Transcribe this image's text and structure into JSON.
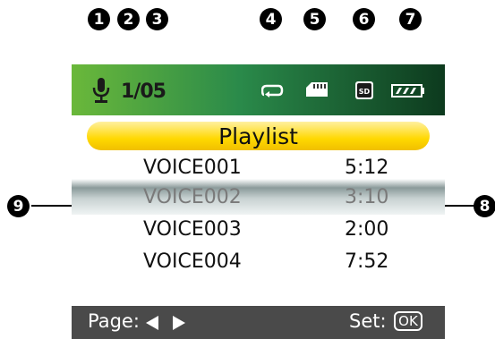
{
  "callouts": [
    "1",
    "2",
    "3",
    "4",
    "5",
    "6",
    "7",
    "8",
    "9"
  ],
  "status": {
    "track": "1/05"
  },
  "playlist": {
    "title": "Playlist",
    "items": [
      {
        "name": "VOICE001",
        "time": "5:12"
      },
      {
        "name": "VOICE002",
        "time": "3:10"
      },
      {
        "name": "VOICE003",
        "time": "2:00"
      },
      {
        "name": "VOICE004",
        "time": "7:52"
      }
    ],
    "selected_index": 1
  },
  "bottom": {
    "page_label": "Page:",
    "set_label": "Set:",
    "ok_label": "OK"
  },
  "icons": [
    "microphone-icon",
    "repeat-icon",
    "memory-card-icon",
    "sd-card-icon",
    "battery-icon",
    "left-arrow-icon",
    "right-arrow-icon"
  ],
  "colors": {
    "status_gradient_start": "#6ab83a",
    "status_gradient_end": "#0d3a1e",
    "title_bar": "#ffd800",
    "bottom_bar": "#4a4a4a",
    "selected_text": "#7a7a7a"
  }
}
